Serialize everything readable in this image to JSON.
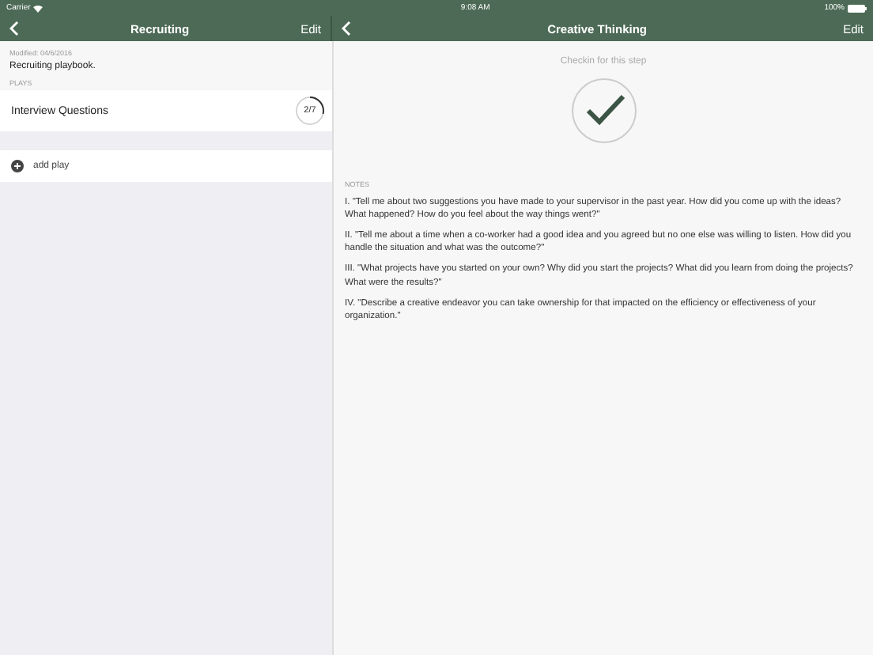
{
  "status_bar": {
    "carrier": "Carrier",
    "time": "9:08 AM",
    "battery": "100%"
  },
  "left": {
    "nav": {
      "title": "Recruiting",
      "action": "Edit"
    },
    "modified": "Modified: 04/6/2016",
    "description": "Recruiting playbook.",
    "section": "PLAYS",
    "plays": [
      {
        "name": "Interview Questions",
        "progress": "2/7",
        "level": 0.2857
      }
    ],
    "add_label": "add play"
  },
  "right": {
    "nav": {
      "title": "Creative Thinking",
      "action": "Edit"
    },
    "checkin_label": "Checkin for this step",
    "checked": true,
    "notes_heading": "NOTES",
    "notes": [
      "I. \"Tell me about two suggestions you have made to your supervisor in the past year. How did you come up with the ideas? What happened? How do you feel about the way things went?\"",
      "II. \"Tell me about a time when a co-worker had a good idea and you agreed but no one else was willing to listen. How did you handle the situation and what was the outcome?\"",
      "III. \"What projects have you started on your own? Why did you start the projects? What did you learn from doing the projects? What were the results?\"",
      "IV. \"Describe a creative endeavor you can take ownership for that impacted on the efficiency or effectiveness of your organization.\""
    ]
  }
}
